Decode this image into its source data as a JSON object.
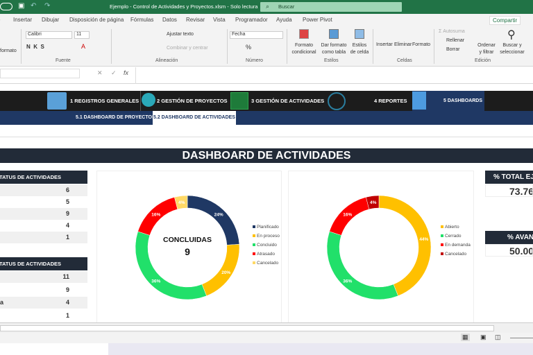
{
  "titlebar": {
    "title": "Ejemplo - Control de Actividades y Proyectos.xlsm  -  Solo lectura",
    "search_placeholder": "Buscar"
  },
  "tabs": [
    "Insertar",
    "Dibujar",
    "Disposición de página",
    "Fórmulas",
    "Datos",
    "Revisar",
    "Vista",
    "Programador",
    "Ayuda",
    "Power Pivot"
  ],
  "share": "Compartir",
  "ribbon": {
    "formato": "formato",
    "font": "Calibri",
    "size": "11",
    "fuente": "Fuente",
    "ajustar": "Ajustar texto",
    "combinar": "Combinar y centrar",
    "alineacion": "Alineación",
    "numfmt": "Fecha",
    "numero": "Número",
    "formato_cond": "Formato condicional",
    "dar_formato": "Dar formato como tabla",
    "estilos_celda": "Estilos de celda",
    "estilos": "Estilos",
    "insertar": "Insertar",
    "eliminar": "Eliminar",
    "formato_c": "Formato",
    "celdas": "Celdas",
    "autosuma": "Autosuma",
    "rellenar": "Rellenar",
    "borrar": "Borrar",
    "ordenar": "Ordenar y filtrar",
    "buscar": "Buscar y seleccionar",
    "edicion": "Edición"
  },
  "nav": [
    "1 REGISTROS GENERALES",
    "2 GESTIÓN DE PROYECTOS",
    "3 GESTIÓN DE ACTIVIDADES",
    "4 REPORTES",
    "5 DASHBOARDS"
  ],
  "subnav": [
    "5.1 DASHBOARD DE PROYECTOS",
    "5.2 DASHBOARD DE ACTIVIDADES"
  ],
  "dashboard_title": "DASHBOARD DE ACTIVIDADES",
  "table1": {
    "header": "STATUS DE ACTIVIDADES",
    "rows": [
      {
        "label": "",
        "value": "6"
      },
      {
        "label": "",
        "value": "5"
      },
      {
        "label": "",
        "value": "9"
      },
      {
        "label": "",
        "value": "4"
      },
      {
        "label": "",
        "value": "1"
      }
    ]
  },
  "table2": {
    "header": "STATUS DE ACTIVIDADES",
    "rows": [
      {
        "label": "",
        "value": "11"
      },
      {
        "label": "",
        "value": "9"
      },
      {
        "label": "a",
        "value": "4"
      },
      {
        "label": "",
        "value": "1"
      }
    ]
  },
  "kpi1": {
    "label": "% TOTAL EJEC",
    "value": "73.76"
  },
  "kpi2": {
    "label": "% AVAN",
    "value": "50.00"
  },
  "chart_data": [
    {
      "type": "pie",
      "donut": true,
      "center_label": "CONCLUIDAS",
      "center_value": "9",
      "legend": "right",
      "categories": [
        "Planificado",
        "En proceso",
        "Concluido",
        "Atrasado",
        "Cancelado"
      ],
      "values": [
        6,
        5,
        9,
        4,
        1
      ],
      "labels": [
        "24%",
        "20%",
        "36%",
        "16%",
        "4%"
      ],
      "colors": [
        "#1f3864",
        "#ffc000",
        "#21e06a",
        "#ff0000",
        "#ffd966"
      ]
    },
    {
      "type": "pie",
      "donut": true,
      "legend": "right",
      "categories": [
        "Abierto",
        "Cerrado",
        "En demanda",
        "Cancelado"
      ],
      "values": [
        11,
        9,
        4,
        1
      ],
      "labels": [
        "44%",
        "36%",
        "16%",
        "4%"
      ],
      "colors": [
        "#ffc000",
        "#21e06a",
        "#ff0000",
        "#c00000"
      ]
    }
  ]
}
